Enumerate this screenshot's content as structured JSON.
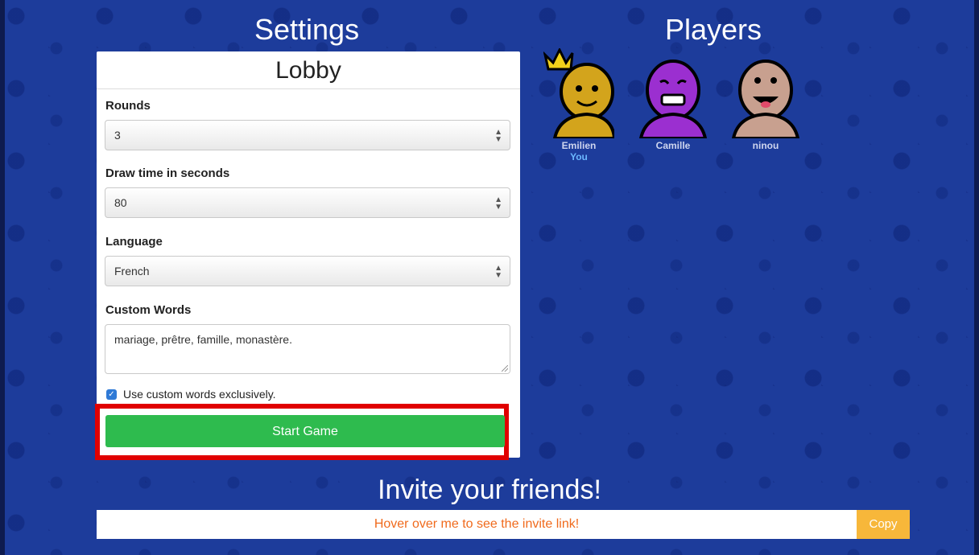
{
  "settings": {
    "title": "Settings",
    "panel_title": "Lobby",
    "rounds": {
      "label": "Rounds",
      "value": "3"
    },
    "draw_time": {
      "label": "Draw time in seconds",
      "value": "80"
    },
    "language": {
      "label": "Language",
      "value": "French"
    },
    "custom_words": {
      "label": "Custom Words",
      "value": "mariage, prêtre, famille, monastère."
    },
    "exclusive": {
      "label": "Use custom words exclusively.",
      "checked": true
    },
    "start_label": "Start Game"
  },
  "players": {
    "title": "Players",
    "list": [
      {
        "name": "Emilien",
        "you": "You",
        "color": "#d3a41c"
      },
      {
        "name": "Camille",
        "color": "#9b2fd0"
      },
      {
        "name": "ninou",
        "color": "#c8a08f"
      }
    ]
  },
  "invite": {
    "title": "Invite your friends!",
    "link_text": "Hover over me to see the invite link!",
    "copy_label": "Copy"
  },
  "colors": {
    "background": "#1d3c9b",
    "start_button": "#2ebb4e",
    "copy_button": "#f7b73a",
    "link_text": "#f06a1c",
    "highlight": "#e00000"
  }
}
